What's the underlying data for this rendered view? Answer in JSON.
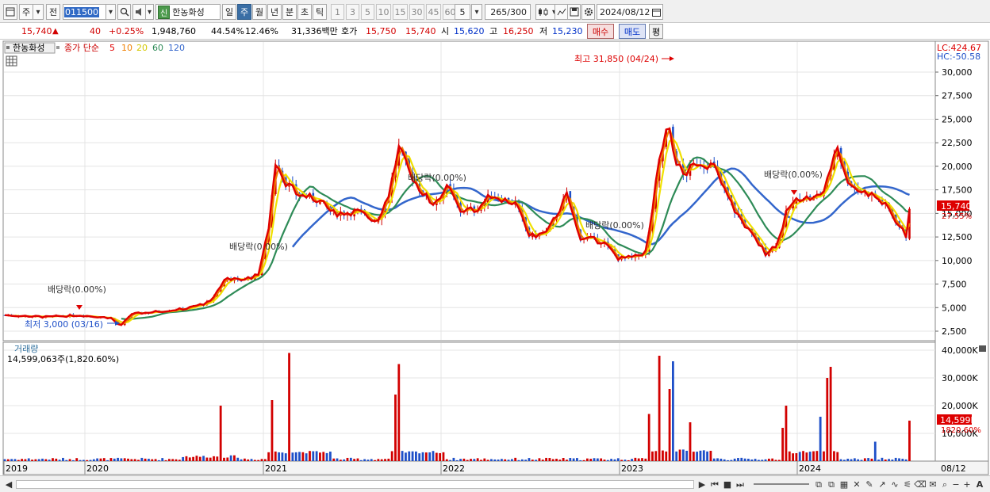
{
  "toolbar": {
    "period_type": "주",
    "prev_label": "전",
    "stock_code": "011500",
    "credit_badge": "신",
    "stock_name": "한농화성",
    "periods": [
      {
        "label": "일",
        "active": false
      },
      {
        "label": "주",
        "active": true
      },
      {
        "label": "월",
        "active": false
      },
      {
        "label": "년",
        "active": false
      },
      {
        "label": "분",
        "active": false
      },
      {
        "label": "초",
        "active": false
      },
      {
        "label": "틱",
        "active": false
      }
    ],
    "intervals": [
      "1",
      "3",
      "5",
      "10",
      "15",
      "30",
      "45",
      "60"
    ],
    "interval_value": "5",
    "count": "265",
    "count_total": "/300",
    "date": "2024/08/12"
  },
  "quote": {
    "price": "15,740",
    "direction_symbol": "▲",
    "change": "40",
    "change_pct": "+0.25%",
    "volume": "1,948,760",
    "vol_ratio": "44.54%",
    "turnover": "12.46%",
    "amount": "31,336백만",
    "bid_label": "호가",
    "ask_price": "15,750",
    "bid_price": "15,740",
    "open_label": "시",
    "open": "15,620",
    "high_label": "고",
    "high": "16,250",
    "low_label": "저",
    "low": "15,230",
    "buy_label": "매수",
    "sell_label": "매도",
    "eval_label": "평"
  },
  "chart": {
    "stock_label": "한농화성",
    "ma_title": "종가 단순",
    "ma_periods": [
      {
        "label": "5",
        "color": "#e00000"
      },
      {
        "label": "10",
        "color": "#f08000"
      },
      {
        "label": "20",
        "color": "#e8e000"
      },
      {
        "label": "60",
        "color": "#2e8b57"
      },
      {
        "label": "120",
        "color": "#3366cc"
      }
    ],
    "lc_label": "LC:424.67",
    "hc_label": "HC:-50.58",
    "price_ticks": [
      "30,000",
      "27,500",
      "25,000",
      "22,500",
      "20,000",
      "17,500",
      "15,000",
      "12,500",
      "10,000",
      "7,500",
      "5,000",
      "2,500"
    ],
    "current_price_tag": "15,740",
    "current_pct_tag": "27.55%",
    "high_annotation": "최고 31,850 (04/24)",
    "low_annotation": "최저 3,000 (03/16)",
    "dividend_labels": [
      "배당락(0.00%)",
      "배당락(0.00%)",
      "배당락(0.00%)",
      "배당락(0.00%)",
      "배당락(0.00%)"
    ],
    "volume_title": "거래량",
    "volume_value": "14,599,063주(1,820.60%)",
    "volume_ticks": [
      "40,000K",
      "30,000K",
      "20,000K",
      "10,000K"
    ],
    "volume_tag": "14,599K",
    "volume_pct_tag": "1820.60%",
    "x_labels": [
      "2019",
      "2020",
      "2021",
      "2022",
      "2023",
      "2024"
    ],
    "last_date_label": "08/12"
  },
  "colors": {
    "up": "#d20000",
    "down": "#1e4fc8",
    "ma5": "#e00000",
    "ma10": "#f08000",
    "ma20": "#f0e000",
    "ma60": "#2e8b57",
    "ma120": "#3366cc"
  }
}
